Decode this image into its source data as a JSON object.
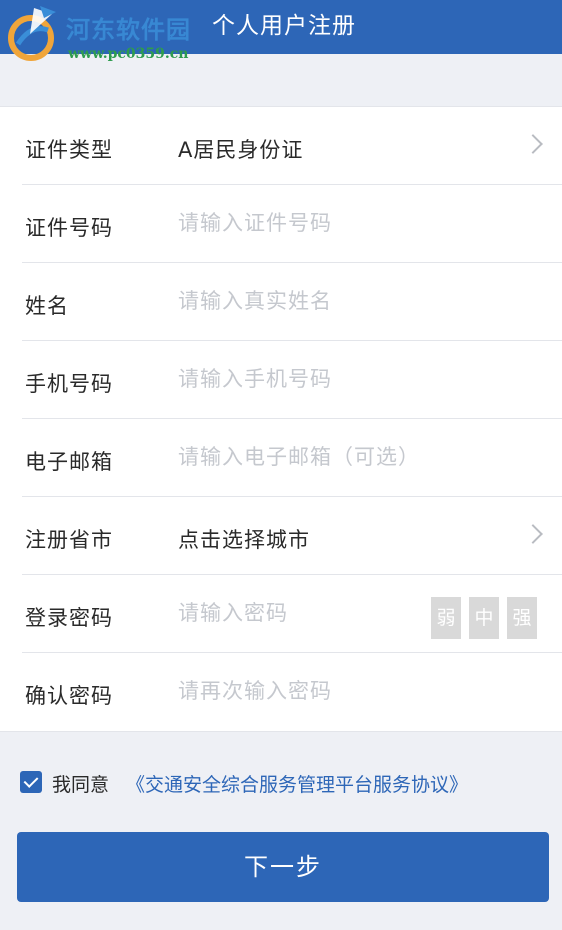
{
  "header": {
    "title": "个人用户注册"
  },
  "watermark": {
    "site_name": "河东软件园",
    "url": "www.pc0359.cn"
  },
  "form": {
    "id_type": {
      "label": "证件类型",
      "value": "A居民身份证"
    },
    "id_number": {
      "label": "证件号码",
      "placeholder": "请输入证件号码"
    },
    "name": {
      "label": "姓名",
      "placeholder": "请输入真实姓名"
    },
    "phone": {
      "label": "手机号码",
      "placeholder": "请输入手机号码"
    },
    "email": {
      "label": "电子邮箱",
      "placeholder": "请输入电子邮箱（可选）"
    },
    "region": {
      "label": "注册省市",
      "value": "点击选择城市"
    },
    "password": {
      "label": "登录密码",
      "placeholder": "请输入密码",
      "strength_labels": [
        "弱",
        "中",
        "强"
      ]
    },
    "confirm_password": {
      "label": "确认密码",
      "placeholder": "请再次输入密码"
    }
  },
  "agreement": {
    "checked": true,
    "text": "我同意",
    "link": "《交通安全综合服务管理平台服务协议》"
  },
  "next_button": {
    "label": "下一步"
  },
  "colors": {
    "primary": "#2d66b7",
    "background": "#eef0f5",
    "placeholder": "#c5c8ce",
    "strength_inactive": "#d9d9d9"
  }
}
